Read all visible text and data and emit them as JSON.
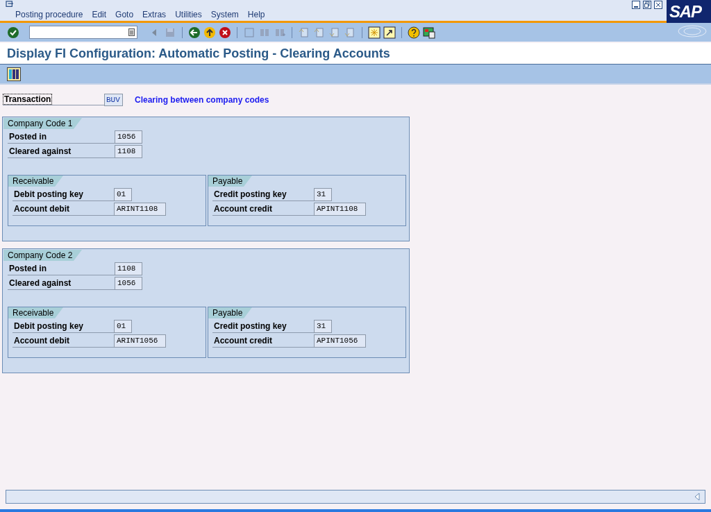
{
  "menu": [
    {
      "label": "Posting procedure"
    },
    {
      "label": "Edit"
    },
    {
      "label": "Goto"
    },
    {
      "label": "Extras"
    },
    {
      "label": "Utilities"
    },
    {
      "label": "System"
    },
    {
      "label": "Help"
    }
  ],
  "logo": "SAP",
  "title": "Display FI Configuration: Automatic Posting - Clearing Accounts",
  "transaction": {
    "label": "Transaction",
    "value": "BUV",
    "description": "Clearing between company codes"
  },
  "company_codes": [
    {
      "title": "Company Code 1",
      "posted_in": {
        "label": "Posted in",
        "value": "1056"
      },
      "cleared_against": {
        "label": "Cleared against",
        "value": "1108"
      },
      "sections": [
        {
          "title": "Receivable",
          "rows": [
            {
              "label": "Debit posting key",
              "value": "01"
            },
            {
              "label": "Account debit",
              "value": "ARINT1108"
            }
          ]
        },
        {
          "title": "Payable",
          "rows": [
            {
              "label": "Credit posting key",
              "value": "31"
            },
            {
              "label": "Account credit",
              "value": "APINT1108"
            }
          ]
        }
      ]
    },
    {
      "title": "Company Code 2",
      "posted_in": {
        "label": "Posted in",
        "value": "1108"
      },
      "cleared_against": {
        "label": "Cleared against",
        "value": "1056"
      },
      "sections": [
        {
          "title": "Receivable",
          "rows": [
            {
              "label": "Debit posting key",
              "value": "01"
            },
            {
              "label": "Account debit",
              "value": "ARINT1056"
            }
          ]
        },
        {
          "title": "Payable",
          "rows": [
            {
              "label": "Credit posting key",
              "value": "31"
            },
            {
              "label": "Account credit",
              "value": "APINT1056"
            }
          ]
        }
      ]
    }
  ]
}
